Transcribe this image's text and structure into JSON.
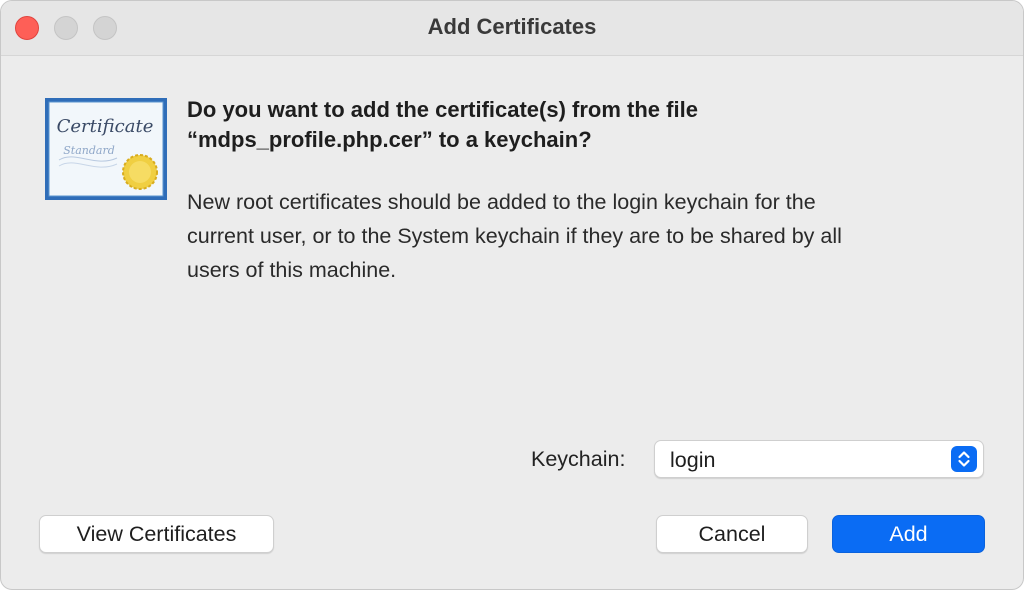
{
  "window": {
    "title": "Add Certificates"
  },
  "icon": {
    "name": "certificate-icon",
    "line1": "Certificate",
    "line2": "Standard"
  },
  "dialog": {
    "heading_line1": "Do you want to add the certificate(s) from the file",
    "heading_line2": "“mdps_profile.php.cer” to a keychain?",
    "body_line1": "New root certificates should be added to the login keychain for the",
    "body_line2": "current user, or to the System keychain if they are to be shared by all",
    "body_line3": "users of this machine."
  },
  "keychain": {
    "label": "Keychain:",
    "selected": "login"
  },
  "buttons": {
    "view_certificates": "View Certificates",
    "cancel": "Cancel",
    "add": "Add"
  },
  "colors": {
    "accent": "#0a6cf4",
    "close": "#fe5f57",
    "window_bg": "#ececec"
  }
}
